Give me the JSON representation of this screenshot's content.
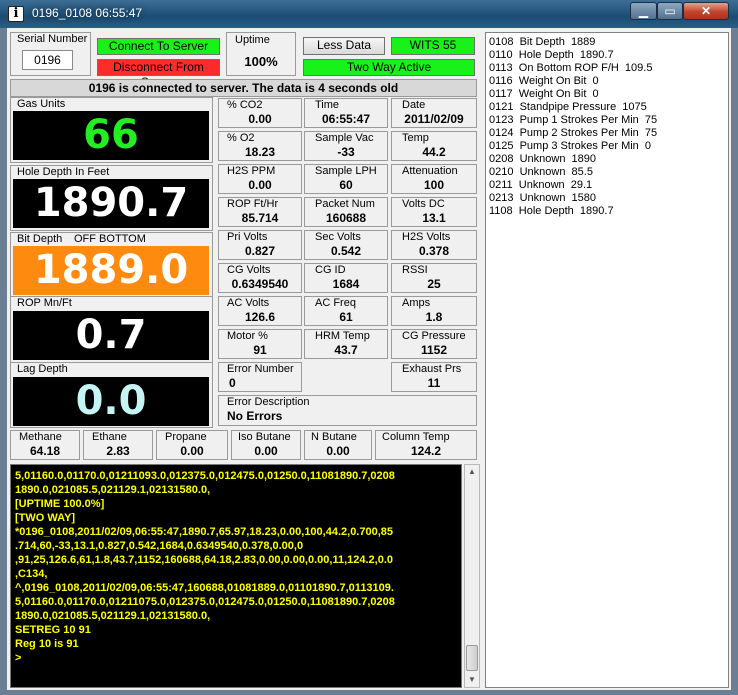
{
  "window": {
    "title": "0196_0108 06:55:47"
  },
  "serial": {
    "label": "Serial Number",
    "value": "0196"
  },
  "buttons": {
    "connect": "Connect To Server",
    "disconnect": "Disconnect From Server",
    "less_data": "Less Data",
    "wits": "WITS 55",
    "two_way": "Two Way Active"
  },
  "uptime": {
    "label": "Uptime",
    "value": "100%"
  },
  "status_message": "0196 is connected to server.  The data is 4 seconds old",
  "big": {
    "gas_units": {
      "label": "Gas Units",
      "value": "66",
      "color": "#22ee22"
    },
    "hole_depth": {
      "label": "Hole Depth In Feet",
      "value": "1890.7",
      "color": "#ffffff"
    },
    "bit_depth": {
      "label": "Bit Depth",
      "status": "OFF BOTTOM",
      "value": "1889.0",
      "color": "#ffffff",
      "bg": "#ff8a10"
    },
    "rop": {
      "label": "ROP Mn/Ft",
      "value": "0.7",
      "color": "#ffffff"
    },
    "lag_depth": {
      "label": "Lag Depth",
      "value": "0.0",
      "color": "#c4f4f4"
    }
  },
  "cells": {
    "co2": {
      "label": "% CO2",
      "value": "0.00"
    },
    "time": {
      "label": "Time",
      "value": "06:55:47"
    },
    "date": {
      "label": "Date",
      "value": "2011/02/09"
    },
    "o2": {
      "label": "% O2",
      "value": "18.23"
    },
    "sample_vac": {
      "label": "Sample Vac",
      "value": "-33"
    },
    "temp": {
      "label": "Temp",
      "value": "44.2"
    },
    "h2s_ppm": {
      "label": "H2S PPM",
      "value": "0.00"
    },
    "sample_lph": {
      "label": "Sample LPH",
      "value": "60"
    },
    "attenuation": {
      "label": "Attenuation",
      "value": "100"
    },
    "rop_ft_hr": {
      "label": "ROP Ft/Hr",
      "value": "85.714"
    },
    "packet_num": {
      "label": "Packet Num",
      "value": "160688"
    },
    "volts_dc": {
      "label": "Volts DC",
      "value": "13.1"
    },
    "pri_volts": {
      "label": "Pri Volts",
      "value": "0.827"
    },
    "sec_volts": {
      "label": "Sec Volts",
      "value": "0.542"
    },
    "h2s_volts": {
      "label": "H2S Volts",
      "value": "0.378"
    },
    "cg_volts": {
      "label": "CG Volts",
      "value": "0.6349540"
    },
    "cg_id": {
      "label": "CG ID",
      "value": "1684"
    },
    "rssi": {
      "label": "RSSI",
      "value": "25"
    },
    "ac_volts": {
      "label": "AC Volts",
      "value": "126.6"
    },
    "ac_freq": {
      "label": "AC Freq",
      "value": "61"
    },
    "amps": {
      "label": "Amps",
      "value": "1.8"
    },
    "motor": {
      "label": "Motor %",
      "value": "91"
    },
    "hrm_temp": {
      "label": "HRM Temp",
      "value": "43.7"
    },
    "cg_pressure": {
      "label": "CG Pressure",
      "value": "1152"
    },
    "error_number": {
      "label": "Error Number",
      "value": "0"
    },
    "exhaust_prs": {
      "label": "Exhaust Prs",
      "value": "11"
    },
    "error_description": {
      "label": "Error Description",
      "value": "No Errors"
    }
  },
  "gases": {
    "methane": {
      "label": "Methane",
      "value": "64.18"
    },
    "ethane": {
      "label": "Ethane",
      "value": "2.83"
    },
    "propane": {
      "label": "Propane",
      "value": "0.00"
    },
    "iso_butane": {
      "label": "Iso Butane",
      "value": "0.00"
    },
    "n_butane": {
      "label": "N Butane",
      "value": "0.00"
    },
    "column_temp": {
      "label": "Column Temp",
      "value": "124.2"
    }
  },
  "console_lines": [
    "5,01160.0,01170.0,01211093.0,012375.0,012475.0,01250.0,11081890.7,0208",
    "1890.0,021085.5,021129.1,02131580.0,",
    "",
    "[UPTIME 100.0%]",
    "[TWO WAY]",
    "",
    "*0196_0108,2011/02/09,06:55:47,1890.7,65.97,18.23,0.00,100,44.2,0.700,85",
    ".714,60,-33,13.1,0.827,0.542,1684,0.6349540,0.378,0.00,0",
    ",91,25,126.6,61,1.8,43.7,1152,160688,64.18,2.83,0.00,0.00,0.00,11,124.2,0.0",
    ",C134,",
    "^,0196_0108,2011/02/09,06:55:47,160688,01081889.0,01101890.7,0113109.",
    "5,01160.0,01170.0,01211075.0,012375.0,012475.0,01250.0,11081890.7,0208",
    "1890.0,021085.5,021129.1,02131580.0,",
    "",
    "SETREG 10 91",
    "Reg 10 is 91",
    ">"
  ],
  "wits_list": [
    "0108  Bit Depth  1889",
    "0110  Hole Depth  1890.7",
    "0113  On Bottom ROP F/H  109.5",
    "0116  Weight On Bit  0",
    "0117  Weight On Bit  0",
    "0121  Standpipe Pressure  1075",
    "0123  Pump 1 Strokes Per Min  75",
    "0124  Pump 2 Strokes Per Min  75",
    "0125  Pump 3 Strokes Per Min  0",
    "0208  Unknown  1890",
    "0210  Unknown  85.5",
    "0211  Unknown  29.1",
    "0213  Unknown  1580",
    "1108  Hole Depth  1890.7"
  ],
  "icons": {
    "app": "info-icon",
    "minimize": "minimize-icon",
    "maximize": "maximize-icon",
    "close": "close-icon"
  }
}
